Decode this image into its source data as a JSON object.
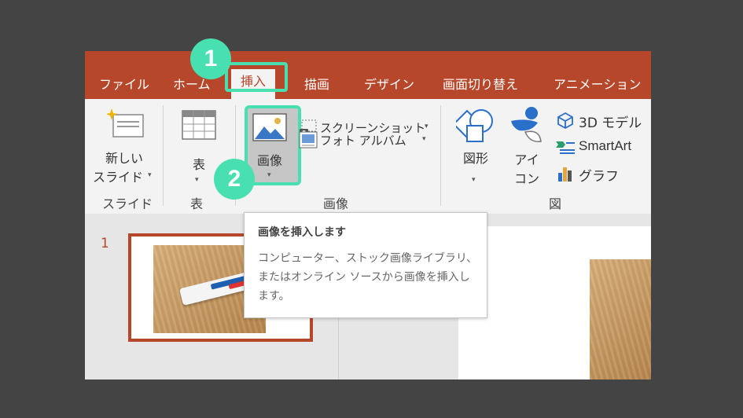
{
  "tabs": [
    {
      "label": "ファイル"
    },
    {
      "label": "ホーム"
    },
    {
      "label": "挿入"
    },
    {
      "label": "描画"
    },
    {
      "label": "デザイン"
    },
    {
      "label": "画面切り替え"
    },
    {
      "label": "アニメーション"
    }
  ],
  "ribbon": {
    "slides_group": {
      "new_slide_line1": "新しい",
      "new_slide_line2": "スライド",
      "caret": "▾",
      "group_label": "スライド"
    },
    "table_group": {
      "table_label": "表",
      "caret": "▾",
      "group_label": "表"
    },
    "images_group": {
      "image_label": "画像",
      "caret": "▾",
      "screenshot_label": "スクリーンショット",
      "screenshot_caret": "▾",
      "photo_album_label": "フォト アルバム",
      "photo_album_caret": "▾",
      "group_label": "画像"
    },
    "illustrations_group": {
      "shapes_label": "図形",
      "shapes_caret": "▾",
      "icons_line1": "アイ",
      "icons_line2": "コン",
      "model3d_label": "3D モデル",
      "smartart_label": "SmartArt",
      "chart_label": "グラフ",
      "group_label": "図"
    }
  },
  "annotations": {
    "step1": "1",
    "step2": "2",
    "accent_color": "#48e0b0"
  },
  "slide_panel": {
    "slide_number": "1"
  },
  "tooltip": {
    "title": "画像を挿入します",
    "body": "コンピューター、ストック画像ライブラリ、またはオンライン ソースから画像を挿入します。"
  },
  "colors": {
    "tab_bar": "#b7472a",
    "ribbon_bg": "#f3f3f3",
    "app_bg": "#444444"
  }
}
